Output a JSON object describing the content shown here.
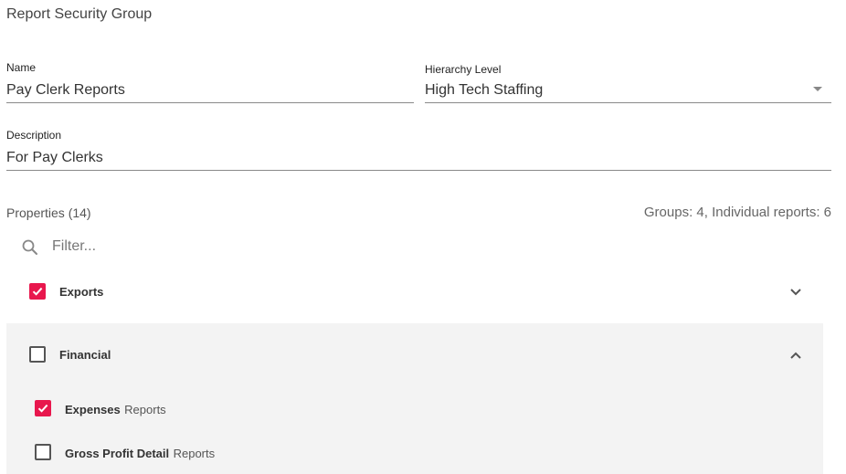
{
  "page": {
    "title": "Report Security Group"
  },
  "form": {
    "name_label": "Name",
    "name_value": "Pay Clerk Reports",
    "hierarchy_label": "Hierarchy Level",
    "hierarchy_value": "High Tech Staffing",
    "description_label": "Description",
    "description_value": "For Pay Clerks"
  },
  "properties": {
    "label": "Properties (14)",
    "summary": "Groups: 4, Individual reports: 6",
    "filter_placeholder": "Filter..."
  },
  "groups": [
    {
      "label": "Exports",
      "checked": true,
      "expanded": false
    },
    {
      "label": "Financial",
      "checked": false,
      "expanded": true,
      "children": [
        {
          "bold": "Expenses",
          "suffix": "Reports",
          "checked": true
        },
        {
          "bold": "Gross Profit Detail",
          "suffix": "Reports",
          "checked": false
        }
      ]
    }
  ],
  "colors": {
    "accent": "#e8174d",
    "panel_bg": "#f3f3f3"
  }
}
